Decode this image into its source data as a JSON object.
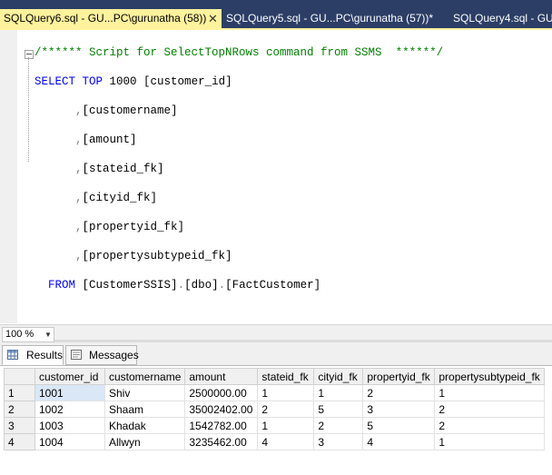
{
  "tabs": [
    {
      "label": "SQLQuery6.sql - GU...PC\\gurunatha (58))",
      "active": true
    },
    {
      "label": "SQLQuery5.sql - GU...PC\\gurunatha (57))*",
      "active": false
    },
    {
      "label": "SQLQuery4.sql - GU",
      "active": false
    }
  ],
  "tab_close_glyph": "✕",
  "editor": {
    "comment": "/****** Script for SelectTopNRows command from SSMS  ******/",
    "select_kw": "SELECT",
    "top_kw": "TOP",
    "top_value": " 1000 [customer_id]",
    "columns": [
      "[customername]",
      "[amount]",
      "[stateid_fk]",
      "[cityid_fk]",
      "[propertyid_fk]",
      "[propertysubtypeid_fk]"
    ],
    "from_kw": "FROM",
    "from_target_1": " [CustomerSSIS]",
    "from_target_2": "[dbo]",
    "from_target_3": "[FactCustomer]"
  },
  "zoom": {
    "value": "100 %"
  },
  "result_tabs": {
    "results": "Results",
    "messages": "Messages"
  },
  "grid": {
    "headers": [
      "customer_id",
      "customername",
      "amount",
      "stateid_fk",
      "cityid_fk",
      "propertyid_fk",
      "propertysubtypeid_fk"
    ],
    "rows": [
      [
        "1",
        "1001",
        "Shiv",
        "2500000.00",
        "1",
        "1",
        "2",
        "1"
      ],
      [
        "2",
        "1002",
        "Shaam",
        "35002402.00",
        "2",
        "5",
        "3",
        "2"
      ],
      [
        "3",
        "1003",
        "Khadak",
        "1542782.00",
        "1",
        "2",
        "5",
        "2"
      ],
      [
        "4",
        "1004",
        "Allwyn",
        "3235462.00",
        "4",
        "3",
        "4",
        "1"
      ]
    ]
  },
  "colors": {
    "tab_strip": "#2c3e66",
    "active_tab": "#fff29d",
    "keyword": "#0000ff",
    "comment": "#008000",
    "selected_cell": "#d9e7f7"
  }
}
